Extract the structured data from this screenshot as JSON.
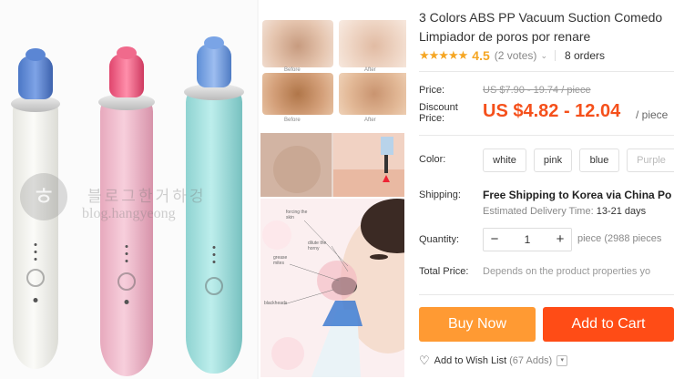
{
  "product": {
    "title_line1": "3 Colors ABS PP Vacuum Suction Comedo",
    "title_line2": "Limpiador de poros por renare",
    "stars": "★★★★★",
    "rating": "4.5",
    "votes": "(2 votes)",
    "orders": "8 orders"
  },
  "price": {
    "label": "Price:",
    "original": "US $7.90 - 19.74 / piece",
    "discount_label_line1": "Discount",
    "discount_label_line2": "Price:",
    "discount": "US $4.82 - 12.04",
    "unit": "/ piece"
  },
  "color": {
    "label": "Color:",
    "options": [
      "white",
      "pink",
      "blue",
      "Purple"
    ]
  },
  "shipping": {
    "label": "Shipping:",
    "value": "Free Shipping to Korea via China Po",
    "delivery_label": "Estimated Delivery Time:",
    "delivery_value": "13-21 days"
  },
  "quantity": {
    "label": "Quantity:",
    "minus": "−",
    "value": "1",
    "plus": "+",
    "note": "piece (2988 pieces"
  },
  "total": {
    "label": "Total Price:",
    "value": "Depends on the product properties yo"
  },
  "actions": {
    "buy_now": "Buy Now",
    "add_to_cart": "Add to Cart",
    "wish_label": "Add to Wish List",
    "wish_count": "(67 Adds)",
    "wish_chevron": "▾"
  },
  "gallery": {
    "watermark_text": "블로그한거하겅",
    "watermark_url": "blog.hangyeong",
    "before_label": "Before",
    "after_label": "After",
    "diagram_labels": [
      "forcing the skin",
      "dilute the horny",
      "grease mites",
      "blackheads"
    ]
  },
  "colors": {
    "accent": "#f5501b",
    "buy": "#ff9a33",
    "cart": "#ff4c16",
    "star": "#f5a623"
  }
}
